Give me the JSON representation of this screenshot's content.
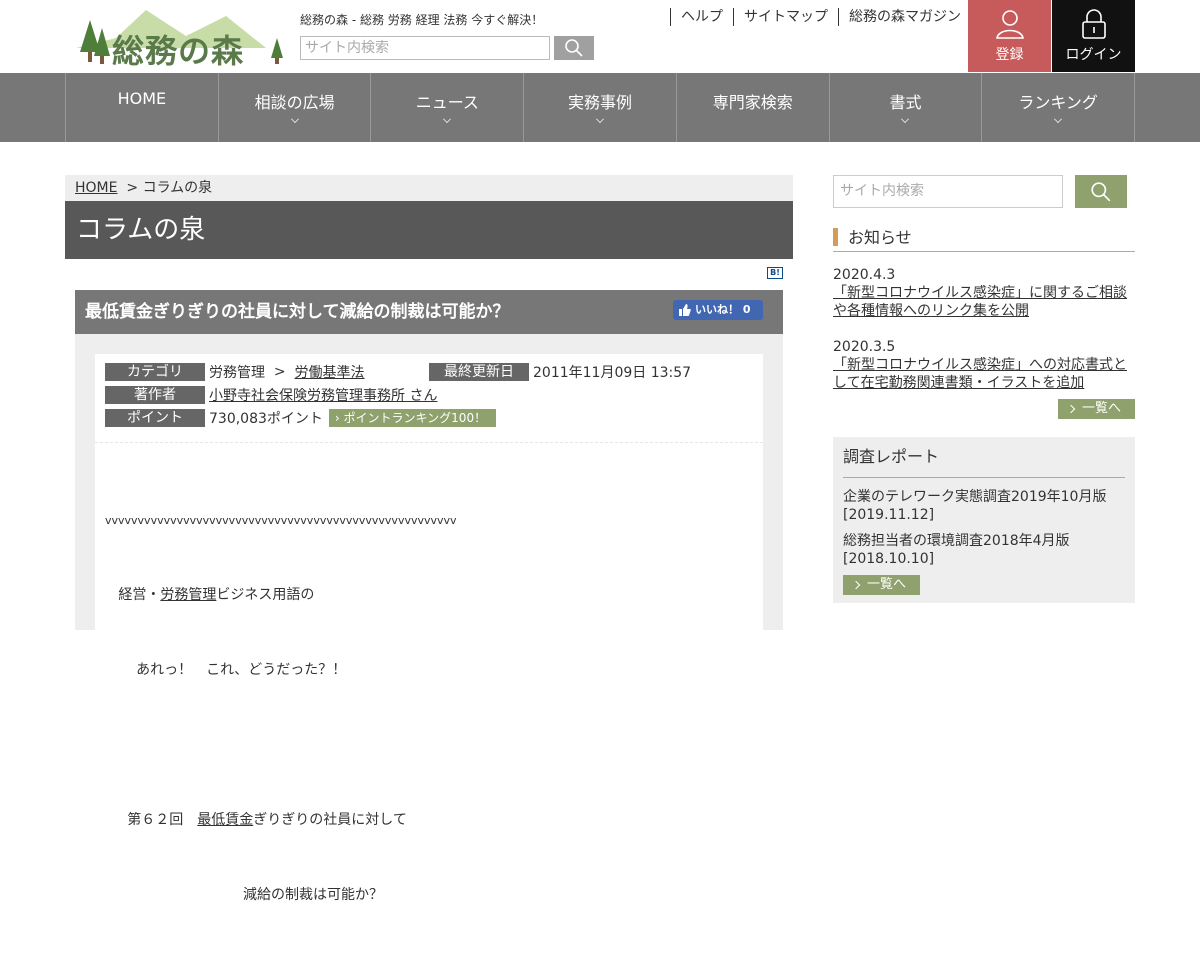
{
  "header": {
    "logo_text": "総務の森",
    "tagline": "総務の森 - 総務 労務 経理 法務 今すぐ解決！",
    "search_placeholder": "サイト内検索",
    "top_links": [
      "ヘルプ",
      "サイトマップ",
      "総務の森マガジン"
    ],
    "register_label": "登録",
    "login_label": "ログイン"
  },
  "nav": [
    "HOME",
    "相談の広場",
    "ニュース",
    "実務事例",
    "専門家検索",
    "書式",
    "ランキング"
  ],
  "breadcrumb": {
    "home": "HOME",
    "separator": ">",
    "current": "コラムの泉"
  },
  "page_title": "コラムの泉",
  "hatena_label": "B!",
  "article": {
    "title": "最低賃金ぎりぎりの社員に対して減給の制裁は可能か？",
    "like_label": "いいね！ 0",
    "category_label": "カテゴリ",
    "category_parent": "労務管理",
    "category_sep": ">",
    "category_child": "労働基準法",
    "updated_label": "最終更新日",
    "updated_value": "2011年11月09日 13:57",
    "author_label": "著作者",
    "author_name": "小野寺社会保険労務管理事務所 さん",
    "points_label": "ポイント",
    "points_value": "730,083ポイント",
    "rank_button": "ポイントランキング100！",
    "body_line1": "vvvvvvvvvvvvvvvvvvvvvvvvvvvvvvvvvvvvvvvvvvvvvvvvvvvvvv",
    "body_line2_pre": "経営・",
    "body_line2_link": "労務管理",
    "body_line2_post": "ビジネス用語の",
    "body_line3": "あれっ！　これ、どうだった？！",
    "body_line4_pre": "第６２回　",
    "body_line4_link": "最低賃金",
    "body_line4_post": "ぎりぎりの社員に対して",
    "body_line5": "減給の制裁は可能か？"
  },
  "sidebar": {
    "search_placeholder": "サイト内検索",
    "notice_heading": "お知らせ",
    "news": [
      {
        "date": "2020.4.3",
        "text": "「新型コロナウイルス感染症」に関するご相談や各種情報へのリンク集を公開"
      },
      {
        "date": "2020.3.5",
        "text": "「新型コロナウイルス感染症」への対応書式として在宅勤務関連書類・イラストを追加"
      }
    ],
    "more_label": "一覧へ",
    "report_heading": "調査レポート",
    "reports": [
      {
        "title": "企業のテレワーク実態調査2019年10月版",
        "date": "[2019.11.12]"
      },
      {
        "title": "総務担当者の環境調査2018年4月版",
        "date": "[2018.10.10]"
      }
    ],
    "report_more_label": "一覧へ"
  },
  "colors": {
    "nav_bg": "#777777",
    "register_bg": "#c75a5a",
    "login_bg": "#111111",
    "accent_green": "#8fa16c",
    "notice_bar": "#d59b5a"
  }
}
